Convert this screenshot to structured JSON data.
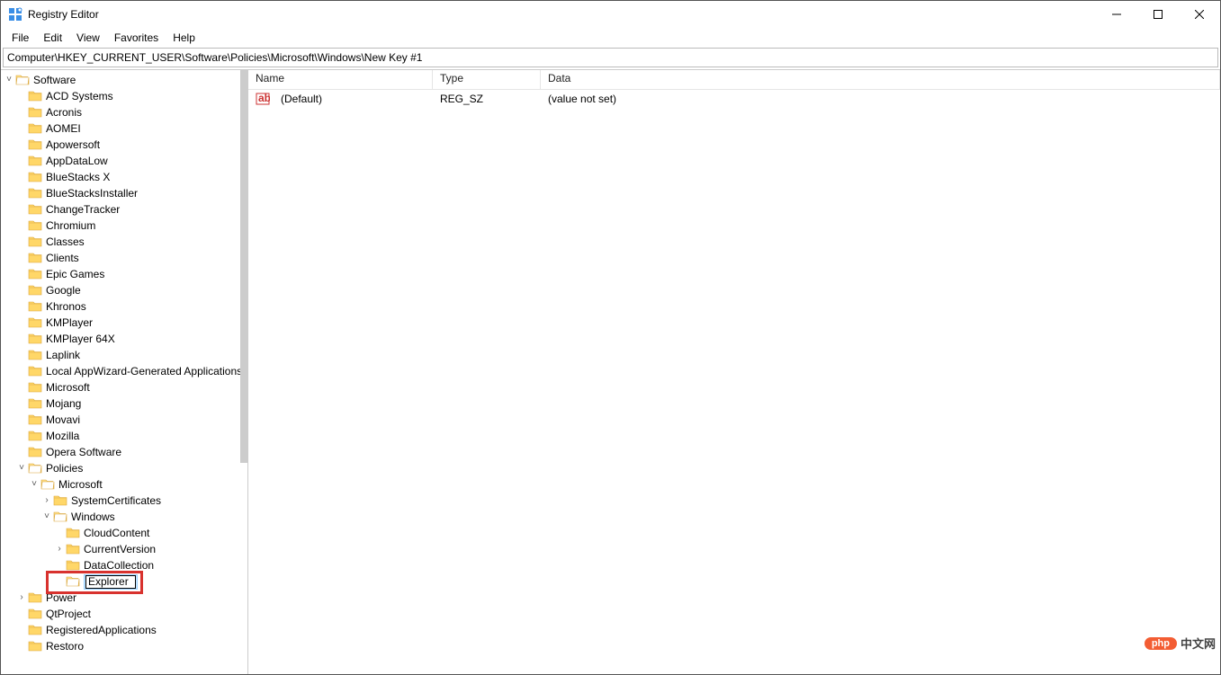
{
  "window": {
    "title": "Registry Editor"
  },
  "menu": {
    "file": "File",
    "edit": "Edit",
    "view": "View",
    "favorites": "Favorites",
    "help": "Help"
  },
  "address": "Computer\\HKEY_CURRENT_USER\\Software\\Policies\\Microsoft\\Windows\\New Key #1",
  "tree": {
    "root": "Software",
    "items": [
      "ACD Systems",
      "Acronis",
      "AOMEI",
      "Apowersoft",
      "AppDataLow",
      "BlueStacks X",
      "BlueStacksInstaller",
      "ChangeTracker",
      "Chromium",
      "Classes",
      "Clients",
      "Epic Games",
      "Google",
      "Khronos",
      "KMPlayer",
      "KMPlayer 64X",
      "Laplink",
      "Local AppWizard-Generated Applications",
      "Microsoft",
      "Mojang",
      "Movavi",
      "Mozilla",
      "Opera Software"
    ],
    "policies": {
      "label": "Policies",
      "microsoft": {
        "label": "Microsoft",
        "children": {
          "syscerts": "SystemCertificates",
          "windows": {
            "label": "Windows",
            "children": {
              "cloud": "CloudContent",
              "current": "CurrentVersion",
              "datacol": "DataCollection"
            }
          }
        }
      }
    },
    "rename_value": "Explorer",
    "after": [
      "Power",
      "QtProject",
      "RegisteredApplications",
      "Restoro"
    ]
  },
  "list": {
    "headers": {
      "name": "Name",
      "type": "Type",
      "data": "Data"
    },
    "row": {
      "name": "(Default)",
      "type": "REG_SZ",
      "data": "(value not set)"
    }
  },
  "watermark": {
    "pill": "php",
    "text": "中文网"
  }
}
